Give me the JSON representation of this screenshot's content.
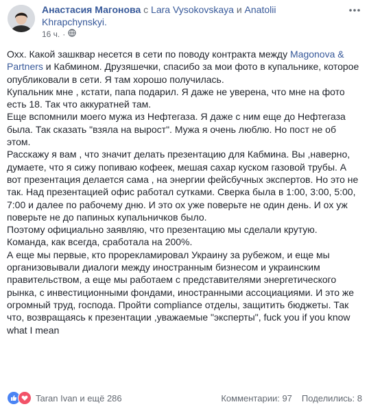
{
  "header": {
    "author": "Анастасия Магонова",
    "with_word": "с",
    "tagged_1": "Lara Vysokovskaya",
    "and_word": "и",
    "tagged_2": "Anatolii Khrapchynskyi.",
    "time": "16 ч."
  },
  "post": {
    "pre_link": "Охх. Какой зашквар несется в сети по поводу контракта между ",
    "link": "Magonova & Partners",
    "post_link": " и Кабмином. Друзяшечки, спасибо за мои фото в купальнике, которое опубликовали в сети. Я там хорошо получилась.",
    "lines": [
      "Купальник мне , кстати, папа подарил. Я даже не уверена, что мне на фото есть 18. Так что аккуратней там.",
      "Еще вспомнили моего мужа из Нефтегаза. Я даже с ним еще до Нефтегаза была. Так сказать \"взяла на вырост\". Мужа я очень люблю. Но пост не об этом.",
      "Расскажу я вам , что значит делать презентацию для Кабмина. Вы ,наверно, думаете, что я сижу попиваю кофеек, мешая сахар куском газовой трубы. А вот презентация делается сама , на энергии фейсбучных экспертов. Но это не так. Над презентацией офис работал сутками. Сверка была в 1:00, 3:00, 5:00, 7:00 и далее по рабочему дню. И это ох уже поверьте не один день. И ох уж поверьте не до папиных купальничков было.",
      "Поэтому официально заявляю, что презентацию мы сделали крутую. Команда, как всегда, сработала на 200%.",
      "А еще мы первые, кто прорекламировал Украину за рубежом, и еще мы организовывали диалоги между иностранным бизнесом и украинским правительством, а еще мы работаем с представителями энергетического рынка, с инвестиционными фондами, иностранными ассоциациями. И это же огромный труд, господа. Пройти compliance отделы, защитить бюджеты. Так что, возвращаясь к презентации ,уважаемые \"эксперты\", fuck you if you know what I mean"
    ]
  },
  "footer": {
    "reactors": "Taran Ivan и ещё 286",
    "comments": "Комментарии: 97",
    "shares": "Поделились: 8"
  },
  "colors": {
    "link": "#365899",
    "text": "#1d2129",
    "muted": "#616770",
    "like": "#4a84f4",
    "love": "#f25268"
  },
  "icons": [
    "avatar",
    "globe-icon",
    "more-icon",
    "like-icon",
    "love-icon"
  ]
}
